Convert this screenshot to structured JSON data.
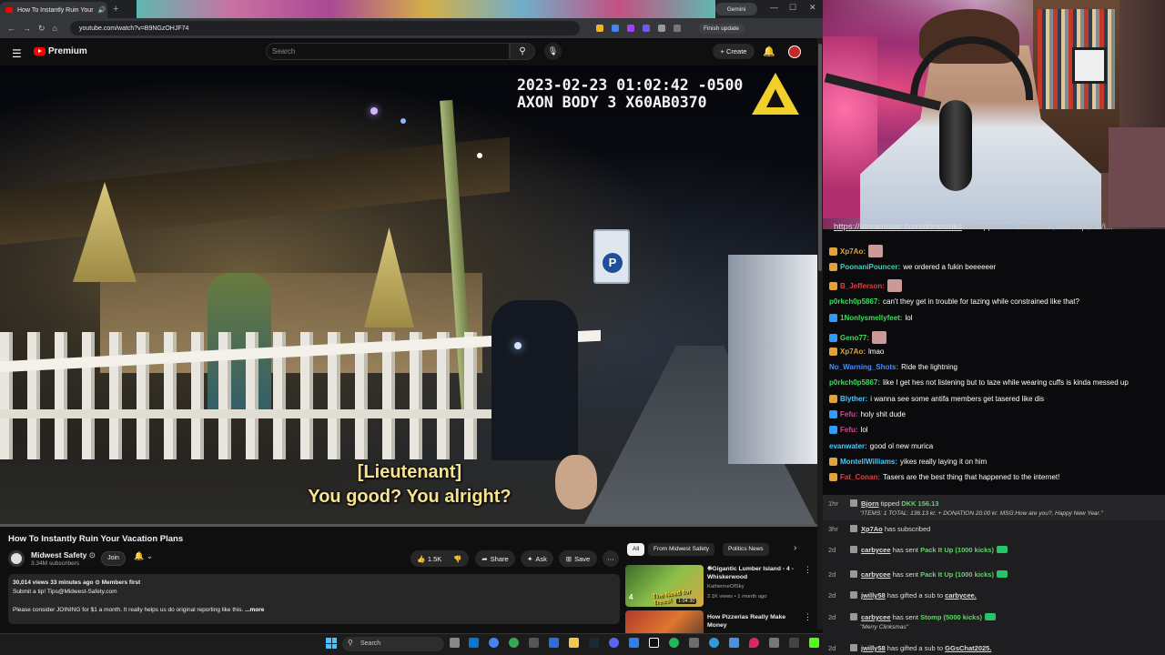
{
  "browser": {
    "tab_title": "How To Instantly Ruin Your",
    "gemini_label": "Gemini",
    "url": "youtube.com/watch?v=B9NGzOHJF74",
    "update_label": "Finish update"
  },
  "youtube": {
    "brand": "Premium",
    "search_placeholder": "Search",
    "create_label": "Create",
    "video": {
      "timestamp_line": "2023-02-23 01:02:42 -0500",
      "device_line": "AXON BODY 3 X60AB0370",
      "subtitle_1": "[Lieutenant]",
      "subtitle_2": "You good? You alright?"
    },
    "title": "How To Instantly Ruin Your Vacation Plans",
    "channel": {
      "name": "Midwest Safety",
      "subscribers": "3.34M subscribers",
      "join_label": "Join"
    },
    "actions": {
      "like_count": "1.5K",
      "share_label": "Share",
      "ask_label": "Ask",
      "save_label": "Save"
    },
    "description": {
      "meta": "30,014 views  33 minutes ago  ⊙ Members first",
      "line1": "Submit a tip! Tips@Midwest-Safety.com",
      "line2": "Please consider JOINING for $1 a month. It really helps us do original reporting like this.",
      "more_label": "...more"
    },
    "chips": [
      "All",
      "From Midwest Safety",
      "Politics News"
    ],
    "recommendations": [
      {
        "title": "⛯Gigantic Lumber Island - 4 - Whiskerwood",
        "channel": "KatherineOfSky",
        "meta": "2.1K views • 1 month ago",
        "duration": "1:04:30",
        "thumb_text": "The Need for Trees!",
        "badge": "4"
      },
      {
        "title": "How Pizzerias Really Make Money",
        "channel": "",
        "meta": "",
        "duration": "",
        "thumb_text": "",
        "badge": ""
      }
    ]
  },
  "taskbar": {
    "search_label": "Search"
  },
  "stream": {
    "chat_link": "https://streamlabs.com/donecinks",
    "chat_link_rest": " to support the stream! $2 TTS | $5 Vi...",
    "chat": [
      {
        "user": "Xp7Ao:",
        "color": "#e0a23a",
        "text": ""
      },
      {
        "user": "PoonaniPouncer:",
        "color": "#3fd0c2",
        "text": "we ordered a fukin beeeeeer"
      },
      {
        "user": "B_Jefferson:",
        "color": "#e04040",
        "text": ""
      },
      {
        "user": "p0rkch0p5867:",
        "color": "#3ddc5a",
        "text": "can't they get in trouble for tazing while constrained like that?"
      },
      {
        "user": "1Nonlysmellyfeet:",
        "color": "#3ddc5a",
        "text": "lol"
      },
      {
        "user": "Geno77:",
        "color": "#3ddc5a",
        "text": ""
      },
      {
        "user": "Xp7Ao:",
        "color": "#e0a23a",
        "text": "lmao"
      },
      {
        "user": "No_Warning_Shots:",
        "color": "#4a8cff",
        "text": "Ride the lightning"
      },
      {
        "user": "p0rkch0p5867:",
        "color": "#3ddc5a",
        "text": "like I get hes not listening but to taze while wearing cuffs is kinda messed up"
      },
      {
        "user": "Blyther:",
        "color": "#4ac8ff",
        "text": "i wanna see some antifa members get tasered like dis"
      },
      {
        "user": "Fefu:",
        "color": "#e04090",
        "text": "holy shit dude"
      },
      {
        "user": "Fefu:",
        "color": "#e04090",
        "text": "lol"
      },
      {
        "user": "evanwater:",
        "color": "#4ac8ff",
        "text": "good ol new murica"
      },
      {
        "user": "MontellWilliams:",
        "color": "#4ac8ff",
        "text": "yikes really laying it on him"
      },
      {
        "user": "Fat_Conan:",
        "color": "#e04040",
        "text": "Tasers are the best thing that happened to the internet!"
      }
    ],
    "events": [
      {
        "time": "1hr",
        "user": "Bjorn",
        "pre": "",
        "action": " tipped ",
        "highlight": "DKK 156.13",
        "note": "\"ITEMS: 1 TOTAL: 136.13 kr. + DONATION 20.00 kr. MSG:How are you?, Happy New Year.\""
      },
      {
        "time": "3hr",
        "user": "Xp7Ao",
        "action": " has subscribed",
        "highlight": "",
        "note": ""
      },
      {
        "time": "2d",
        "user": "carbycee",
        "action": " has sent ",
        "highlight": "Pack It Up (1000 kicks)",
        "note": ""
      },
      {
        "time": "2d",
        "user": "carbycee",
        "action": " has sent ",
        "highlight": "Pack It Up (1000 kicks)",
        "note": ""
      },
      {
        "time": "2d",
        "user": "jwilly58",
        "action": " has gifted a sub to ",
        "highlight": "",
        "target": "carbycee.",
        "note": ""
      },
      {
        "time": "2d",
        "user": "carbycee",
        "action": " has sent ",
        "highlight": "Stomp (5000 kicks)",
        "note": "\"Merry Clinksmas\""
      },
      {
        "time": "2d",
        "user": "jwilly58",
        "action": " has gifted a sub to ",
        "highlight": "",
        "target": "GGsChat2025.",
        "note": ""
      }
    ]
  }
}
